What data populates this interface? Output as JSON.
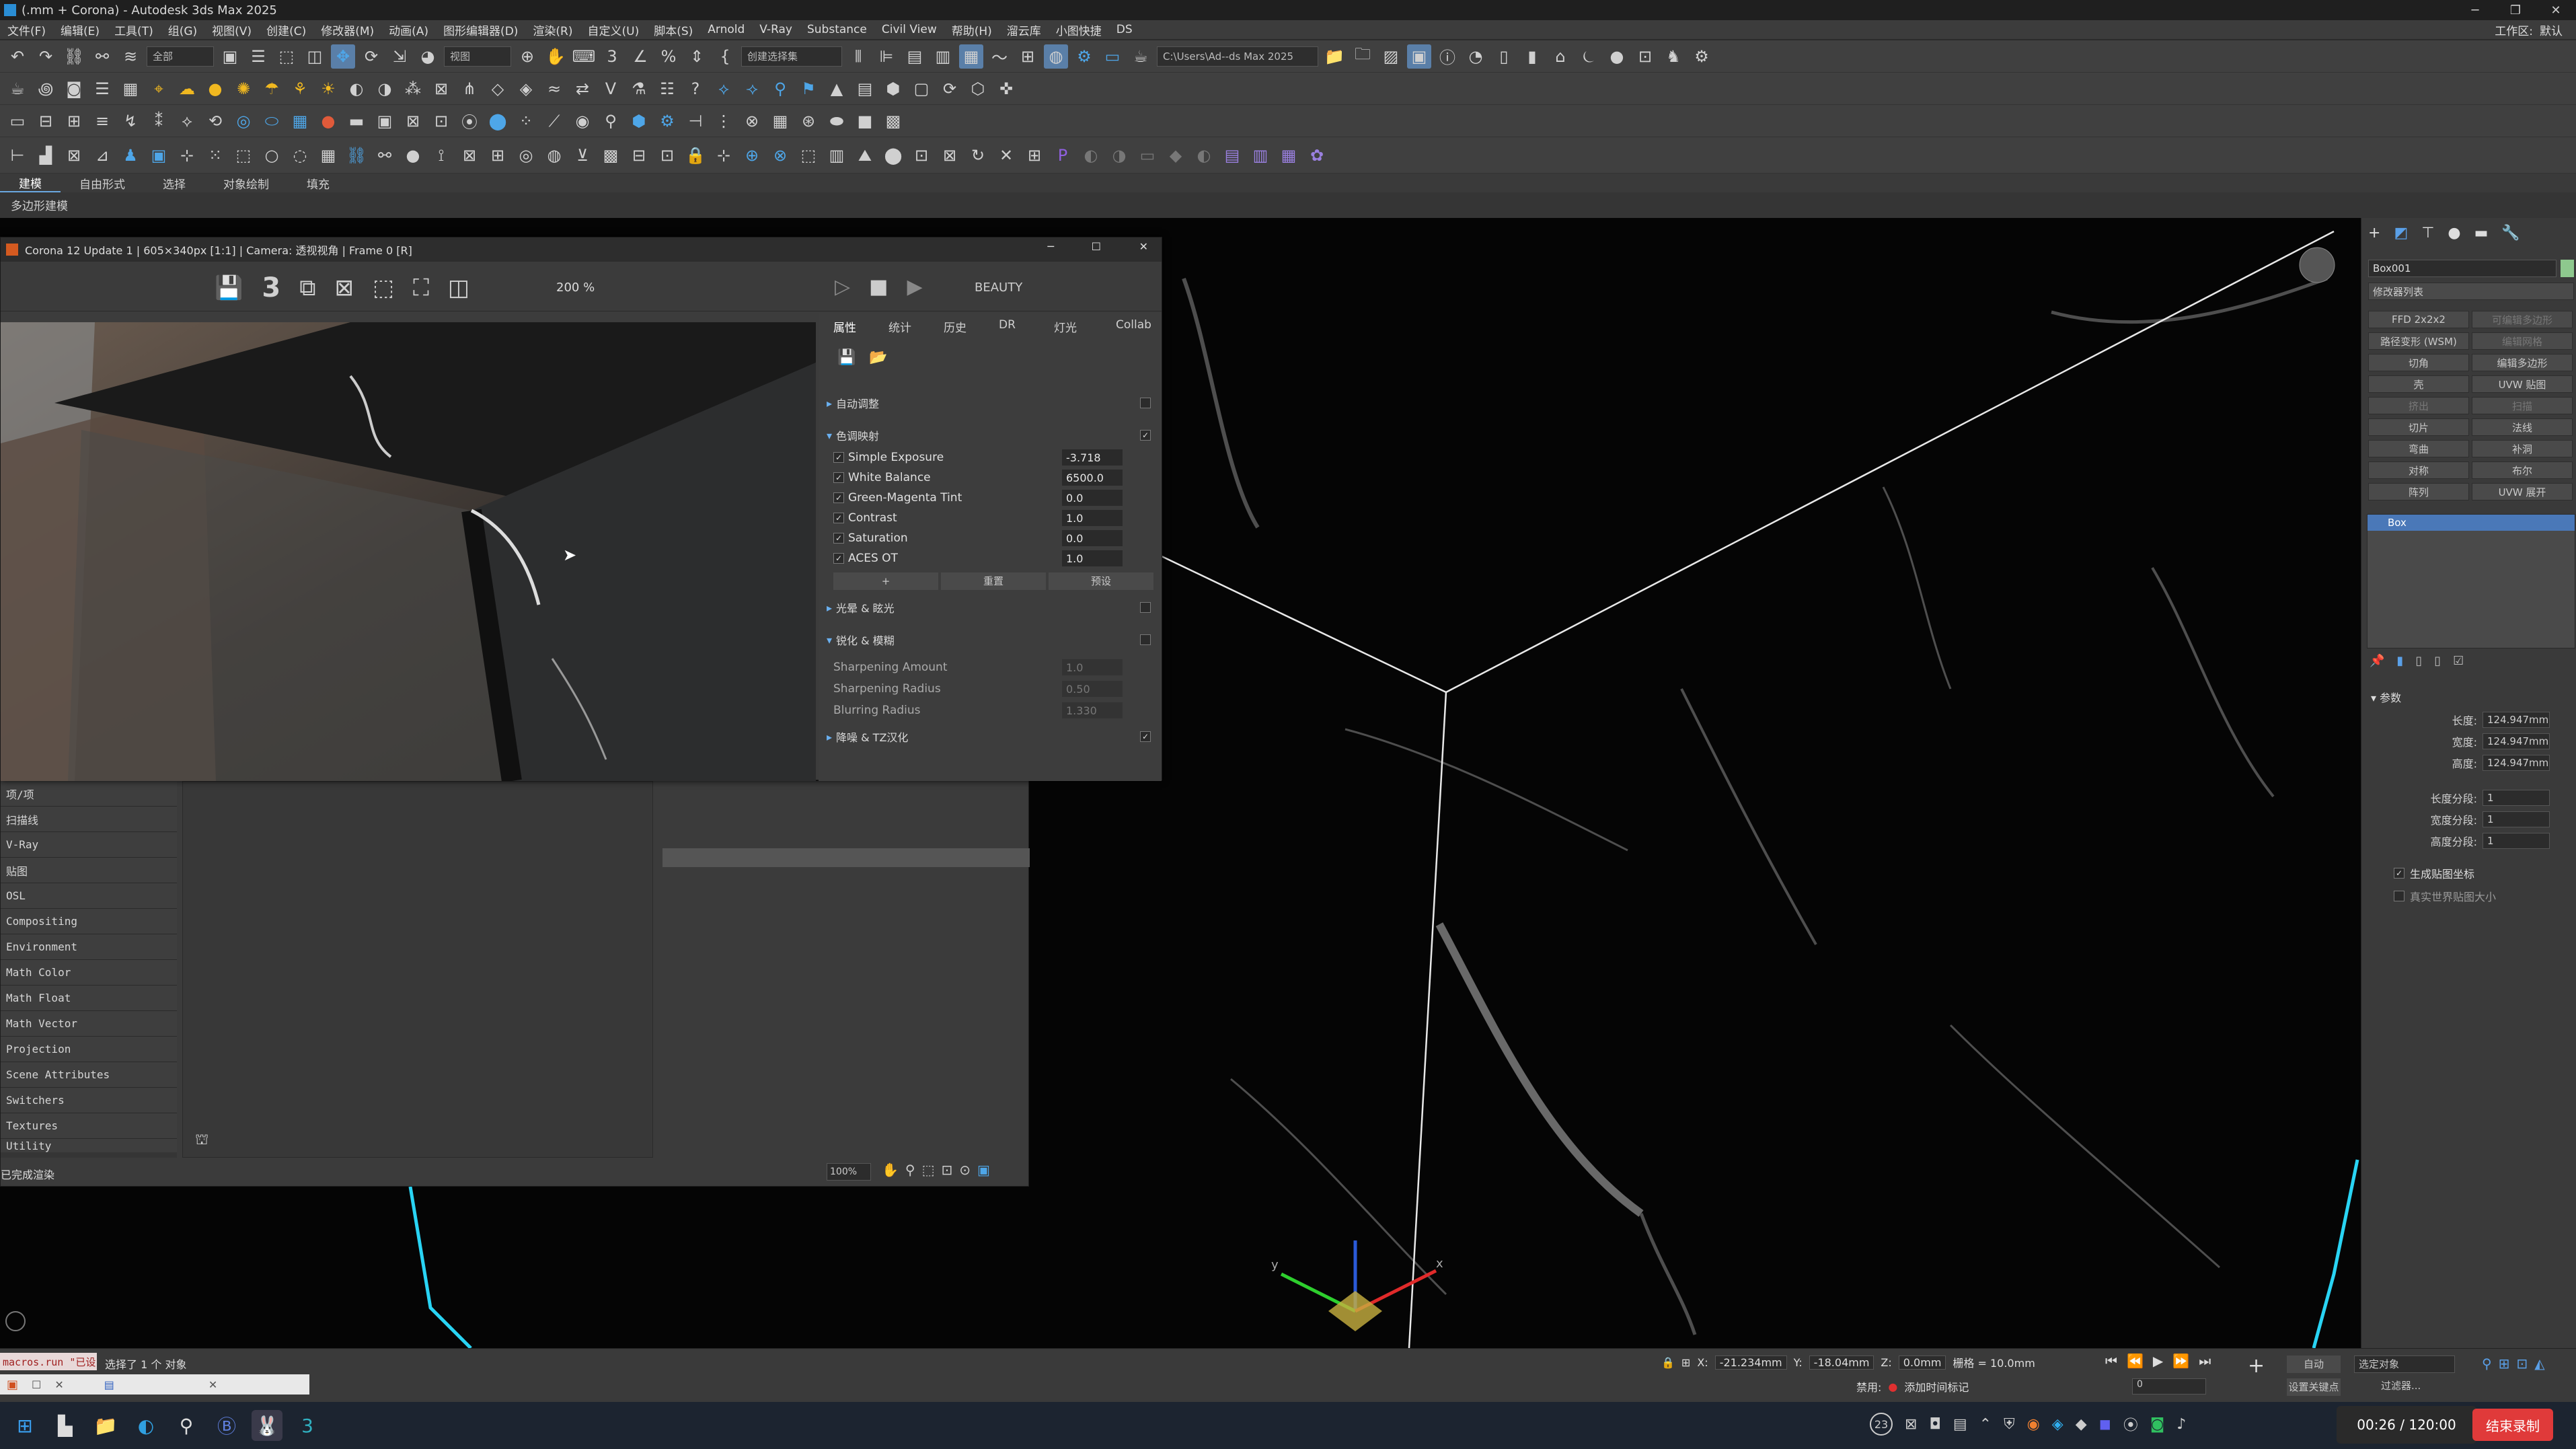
{
  "window": {
    "title": "(.mm + Corona) - Autodesk 3ds Max 2025",
    "minimize": "─",
    "maximize": "❐",
    "close": "✕"
  },
  "menu": {
    "items": [
      "文件(F)",
      "编辑(E)",
      "工具(T)",
      "组(G)",
      "视图(V)",
      "创建(C)",
      "修改器(M)",
      "动画(A)",
      "图形编辑器(D)",
      "渲染(R)",
      "自定义(U)",
      "脚本(S)",
      "Arnold",
      "V-Ray",
      "Substance",
      "Civil View",
      "帮助(H)",
      "溜云库",
      "小图快捷",
      "DS"
    ],
    "workspace_label": "工作区:",
    "workspace_value": "默认"
  },
  "toolbar": {
    "selection_filter": "全部",
    "view_combo": "视图",
    "selection_set": "创建选择集",
    "path": "C:\\Users\\Ad--ds Max 2025"
  },
  "ribbon": {
    "tabs": [
      "建模",
      "自由形式",
      "选择",
      "对象绘制",
      "填充"
    ],
    "active": "建模",
    "subribbon": "多边形建模"
  },
  "corona": {
    "caption": "Corona 12 Update 1 | 605×340px [1:1] | Camera: 透视视角 | Frame 0 [R]",
    "zoom": "200 %",
    "pass": "BEAUTY",
    "tabs": [
      "属性",
      "统计",
      "历史",
      "DR",
      "灯光",
      "Collab"
    ],
    "active_tab": "属性",
    "sections": {
      "auto": "自动调整",
      "tone": "色调映射",
      "bloom": "光晕 & 眩光",
      "sharpen": "锐化 & 模糊",
      "denoise": "降噪 & TZ汉化"
    },
    "tone_params": [
      {
        "name": "Simple Exposure",
        "value": "-3.718"
      },
      {
        "name": "White Balance",
        "value": "6500.0"
      },
      {
        "name": "Green-Magenta Tint",
        "value": "0.0"
      },
      {
        "name": "Contrast",
        "value": "1.0"
      },
      {
        "name": "Saturation",
        "value": "0.0"
      },
      {
        "name": "ACES OT",
        "value": "1.0"
      }
    ],
    "tone_buttons": [
      "+",
      "重置",
      "预设"
    ],
    "sharpen_params": [
      {
        "name": "Sharpening Amount",
        "value": "1.0"
      },
      {
        "name": "Sharpening Radius",
        "value": "0.50"
      },
      {
        "name": "Blurring Radius",
        "value": "1.330"
      }
    ],
    "beauty_label": "BEAUTY",
    "three_label": "3"
  },
  "slate": {
    "list": [
      "项/项",
      "扫描线",
      "V-Ray",
      "贴图",
      "OSL",
      "Compositing",
      "Environment",
      "Math Color",
      "Math Float",
      "Math Vector",
      "Projection",
      "Scene Attributes",
      "Switchers",
      "Textures",
      "Utility"
    ],
    "status": "已完成渲染",
    "zoom": "100%"
  },
  "command_panel": {
    "object_name": "Box001",
    "modifier_list": "修改器列表",
    "buttons": [
      "FFD 2x2x2",
      "可编辑多边形",
      "路径变形 (WSM)",
      "编辑网格",
      "切角",
      "编辑多边形",
      "壳",
      "UVW 贴图",
      "挤出",
      "扫描",
      "切片",
      "法线",
      "弯曲",
      "补洞",
      "对称",
      "布尔",
      "阵列",
      "UVW 展开"
    ],
    "stack_item": "Box",
    "params_title": "参数",
    "params": [
      {
        "label": "长度:",
        "value": "124.947mm"
      },
      {
        "label": "宽度:",
        "value": "124.947mm"
      },
      {
        "label": "高度:",
        "value": "124.947mm"
      },
      {
        "label": "长度分段:",
        "value": "1"
      },
      {
        "label": "宽度分段:",
        "value": "1"
      },
      {
        "label": "高度分段:",
        "value": "1"
      }
    ],
    "gen_uv": "生成贴图坐标",
    "real_world": "真实世界贴图大小"
  },
  "status": {
    "script": "macros.run \"已设",
    "selection": "选择了 1 个 对象",
    "x": "-21.234mm",
    "y": "-18.04mm",
    "z": "0.0mm",
    "grid": "栅格 = 10.0mm",
    "auto": "自动",
    "set_key": "设置关键点",
    "filter": "过滤器...",
    "selected": "选定对象",
    "disabled": "禁用:",
    "add_tag": "添加时间标记",
    "frame": "0"
  },
  "recording": {
    "time": "00:26 / 120:00",
    "stop": "结束录制"
  },
  "taskbar": {
    "badge": "23"
  }
}
